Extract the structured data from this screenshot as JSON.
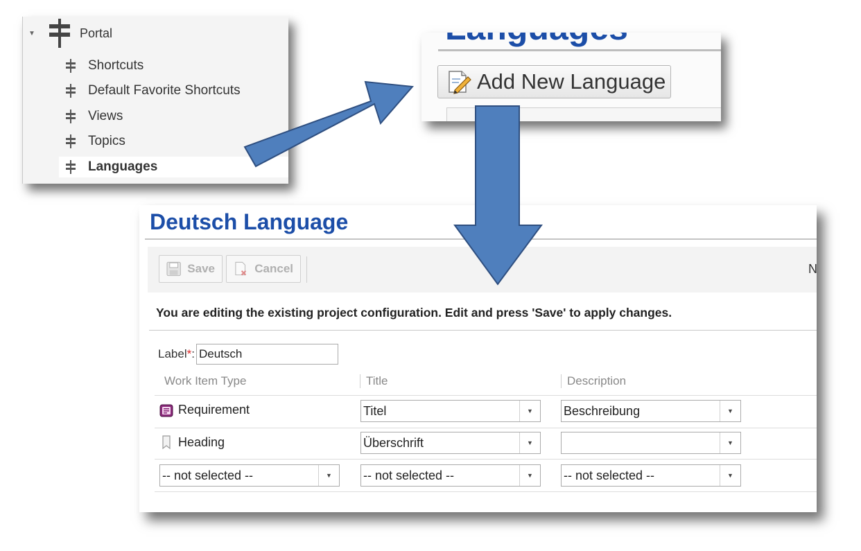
{
  "tree": {
    "root_label": "Portal",
    "items": [
      {
        "label": "Shortcuts",
        "selected": false
      },
      {
        "label": "Default Favorite Shortcuts",
        "selected": false
      },
      {
        "label": "Views",
        "selected": false
      },
      {
        "label": "Topics",
        "selected": false
      },
      {
        "label": "Languages",
        "selected": true
      }
    ]
  },
  "languages_panel": {
    "title": "Languages",
    "add_button_label": "Add New Language"
  },
  "editor": {
    "title": "Deutsch Language",
    "toolbar": {
      "save_label": "Save",
      "cancel_label": "Cancel",
      "cut_text": "N"
    },
    "info": "You are editing the existing project configuration. Edit and press 'Save' to apply changes.",
    "label_field": {
      "label": "Label",
      "required_mark": "*",
      "colon": ":",
      "value": "Deutsch"
    },
    "columns": {
      "type": "Work Item Type",
      "title": "Title",
      "description": "Description"
    },
    "rows": [
      {
        "type": "Requirement",
        "type_icon": "requirement-icon",
        "title": "Titel",
        "description": "Beschreibung"
      },
      {
        "type": "Heading",
        "type_icon": "heading-icon",
        "title": "Überschrift",
        "description": ""
      },
      {
        "type": "-- not selected --",
        "title": "-- not selected --",
        "description": "-- not selected --"
      }
    ]
  },
  "colors": {
    "title_blue": "#1c4ea8",
    "arrow_fill": "#4f7fbd",
    "arrow_stroke": "#2f4f80",
    "required": "#dd2222"
  }
}
